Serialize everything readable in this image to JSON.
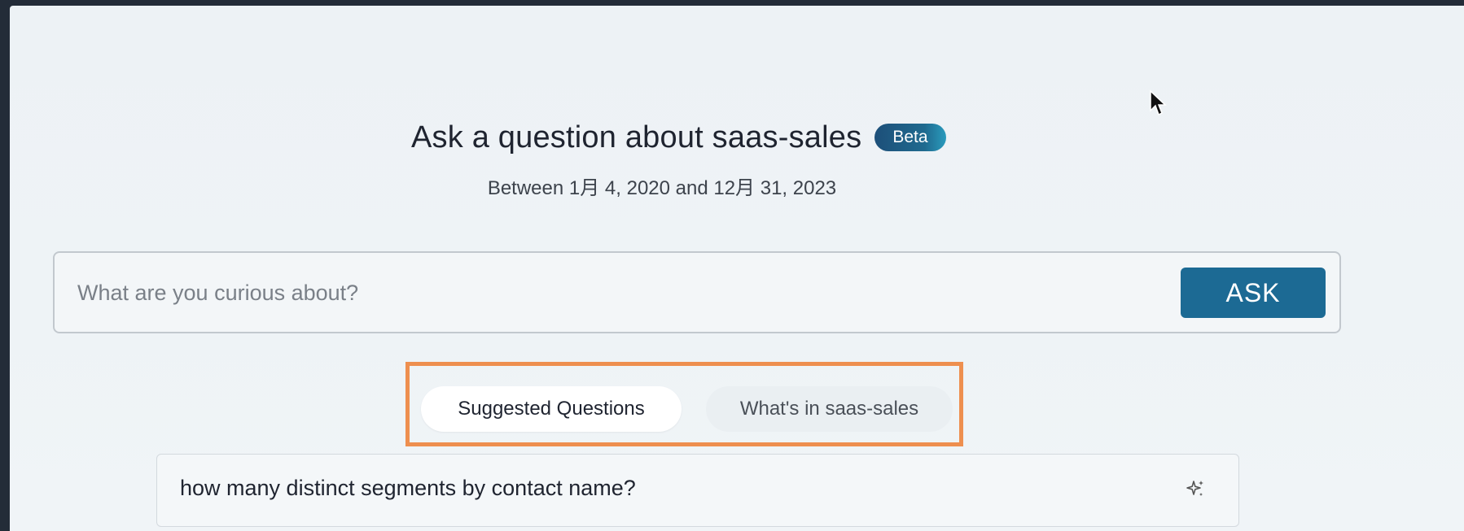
{
  "header": {
    "title": "Ask a question about saas-sales",
    "badge": "Beta",
    "subtitle": "Between 1月 4, 2020 and 12月 31, 2023"
  },
  "search": {
    "placeholder": "What are you curious about?",
    "value": "",
    "ask_label": "ASK"
  },
  "tabs": [
    {
      "label": "Suggested Questions",
      "active": true
    },
    {
      "label": "What's in saas-sales",
      "active": false
    }
  ],
  "questions": [
    {
      "text": "how many distinct segments by contact name?",
      "icon": "sparkle-icon"
    }
  ],
  "colors": {
    "ask_button": "#1c6a94",
    "highlight_border": "#ee8f4f",
    "badge": "#1d4f79"
  }
}
